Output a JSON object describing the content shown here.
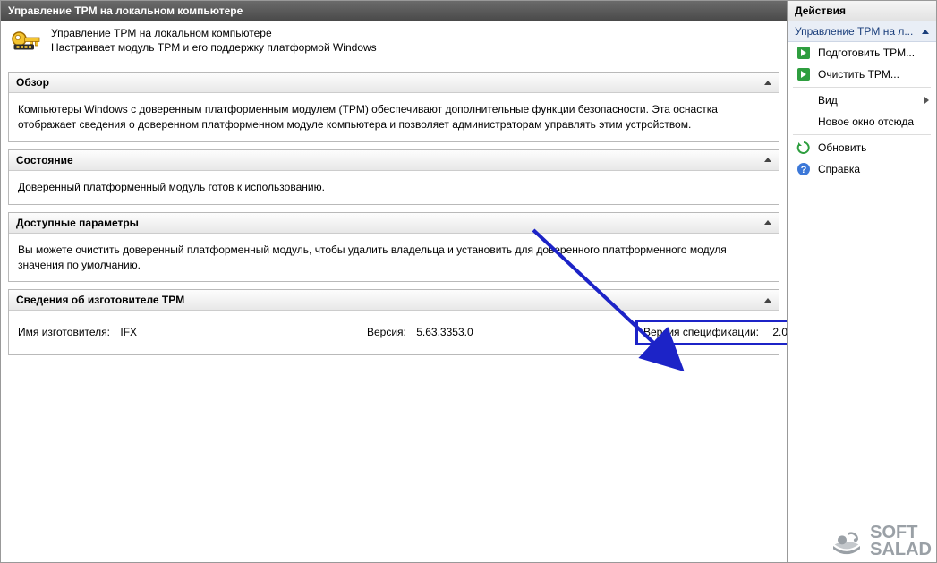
{
  "window": {
    "title": "Управление TPM на локальном компьютере"
  },
  "header": {
    "title": "Управление TPM на локальном компьютере",
    "subtitle": "Настраивает модуль TPM и его поддержку платформой Windows"
  },
  "sections": {
    "overview": {
      "title": "Обзор",
      "body": "Компьютеры Windows с доверенным платформенным модулем (TPM) обеспечивают дополнительные функции безопасности. Эта оснастка отображает сведения о доверенном платформенном модуле компьютера и позволяет администраторам управлять этим устройством."
    },
    "status": {
      "title": "Состояние",
      "body": "Доверенный платформенный модуль готов к использованию."
    },
    "available": {
      "title": "Доступные параметры",
      "body": "Вы можете очистить доверенный платформенный модуль, чтобы удалить владельца и установить для доверенного платформенного модуля значения по умолчанию."
    },
    "mfg": {
      "title": "Сведения об изготовителе TPM",
      "name_label": "Имя изготовителя:",
      "name_value": "IFX",
      "version_label": "Версия:",
      "version_value": "5.63.3353.0",
      "spec_label": "Версия спецификации:",
      "spec_value": "2.0"
    }
  },
  "actions": {
    "title": "Действия",
    "group": "Управление TPM на л...",
    "items": [
      {
        "label": "Подготовить TPM...",
        "icon": "arrow-green"
      },
      {
        "label": "Очистить TPM...",
        "icon": "arrow-green"
      },
      {
        "label": "Вид",
        "icon": "none",
        "submenu": true
      },
      {
        "label": "Новое окно отсюда",
        "icon": "none"
      },
      {
        "label": "Обновить",
        "icon": "refresh"
      },
      {
        "label": "Справка",
        "icon": "help"
      }
    ]
  },
  "watermark": {
    "line1": "SOFT",
    "line2": "SALAD"
  }
}
